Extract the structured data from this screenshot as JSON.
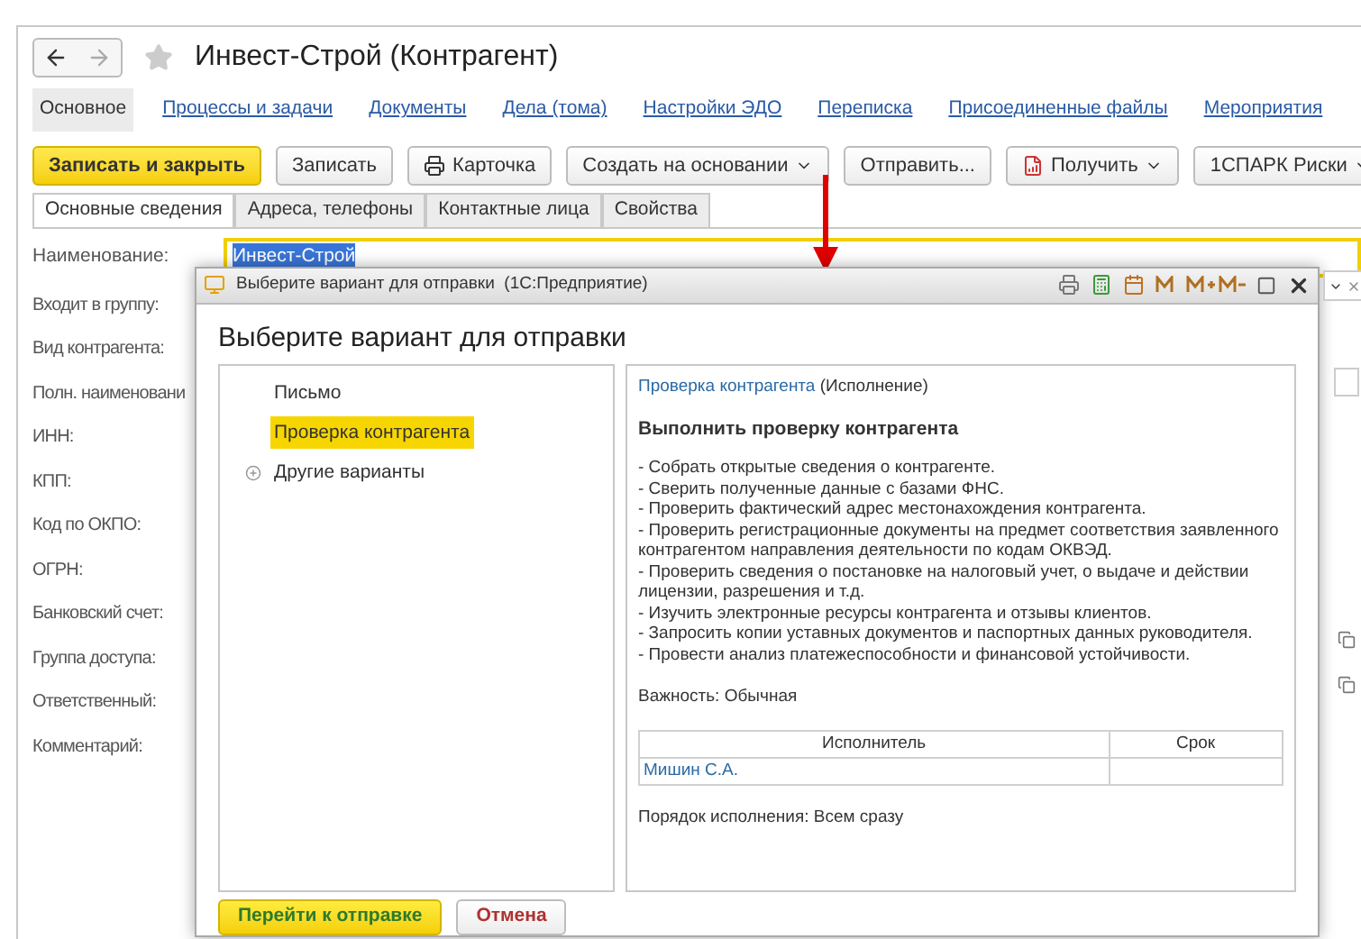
{
  "window": {
    "title": "Инвест-Строй (Контрагент)",
    "favorite": false
  },
  "nav_tabs": [
    {
      "label": "Основное",
      "selected": true
    },
    {
      "label": "Процессы и задачи",
      "selected": false
    },
    {
      "label": "Документы",
      "selected": false
    },
    {
      "label": "Дела (тома)",
      "selected": false
    },
    {
      "label": "Настройки ЭДО",
      "selected": false
    },
    {
      "label": "Переписка",
      "selected": false
    },
    {
      "label": "Присоединенные файлы",
      "selected": false
    },
    {
      "label": "Мероприятия",
      "selected": false
    }
  ],
  "toolbar": [
    {
      "label": "Записать и закрыть",
      "kind": "primary"
    },
    {
      "label": "Записать",
      "kind": "plain"
    },
    {
      "label": "Карточка",
      "kind": "print"
    },
    {
      "label": "Создать на основании",
      "kind": "dropdown"
    },
    {
      "label": "Отправить...",
      "kind": "plain"
    },
    {
      "label": "Получить",
      "kind": "report"
    },
    {
      "label": "1СПАРК Риски",
      "kind": "dropdown"
    }
  ],
  "form_tabs": [
    {
      "label": "Основные сведения",
      "selected": true
    },
    {
      "label": "Адреса, телефоны",
      "selected": false
    },
    {
      "label": "Контактные лица",
      "selected": false
    },
    {
      "label": "Свойства",
      "selected": false
    }
  ],
  "name_field": {
    "label": "Наименование:",
    "value": "Инвест-Строй"
  },
  "field_labels": [
    "Входит в группу:",
    "Вид контрагента:",
    "Полн. наименовани",
    "ИНН:",
    "КПП:",
    "Код по ОКПО:",
    "ОГРН:",
    "Банковский счет:",
    "Группа доступа:",
    "Ответственный:",
    "Комментарий:"
  ],
  "dialog": {
    "title": "Выберите вариант для отправки  (1С:Предприятие)",
    "heading": "Выберите вариант для отправки",
    "options": [
      {
        "label": "Письмо",
        "kind": "item",
        "selected": false
      },
      {
        "label": "Проверка контрагента",
        "kind": "item",
        "selected": true
      },
      {
        "label": "Другие варианты",
        "kind": "group",
        "selected": false
      }
    ],
    "detail": {
      "link": "Проверка контрагента",
      "link_suffix": "(Исполнение)",
      "heading": "Выполнить проверку контрагента",
      "lines": [
        "- Собрать открытые сведения о контрагенте.",
        "- Сверить полученные данные с базами ФНС.",
        "- Проверить фактический адрес местонахождения контрагента.",
        "- Проверить регистрационные документы на предмет соответствия заявленного контрагентом направления деятельности по кодам ОКВЭД.",
        "- Проверить сведения о постановке на налоговый учет, о выдаче и действии лицензии, разрешения и т.д.",
        "- Изучить электронные ресурсы контрагента и отзывы клиентов.",
        "- Запросить копии уставных документов и паспортных данных руководителя.",
        "- Провести анализ платежеспособности и финансовой устойчивости."
      ],
      "importance": "Важность: Обычная",
      "table": {
        "columns": [
          "Исполнитель",
          "Срок"
        ],
        "rows": [
          {
            "executor": "Мишин С.А."
          }
        ]
      },
      "order": "Порядок исполнения: Всем сразу"
    },
    "buttons": [
      {
        "label": "Перейти к отправке",
        "kind": "primary"
      },
      {
        "label": "Отмена",
        "kind": "cancel"
      }
    ]
  }
}
